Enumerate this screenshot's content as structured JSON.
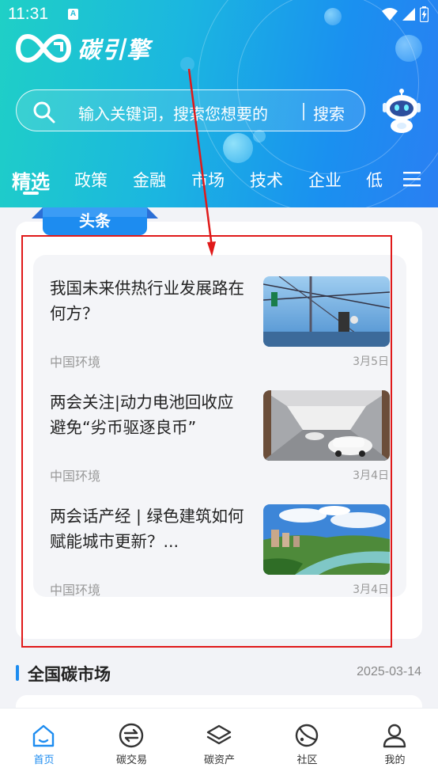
{
  "status_bar": {
    "time": "11:31",
    "notification_badge": "A"
  },
  "app": {
    "name": "碳引擎",
    "accent_color": "#1d8cf0"
  },
  "search": {
    "placeholder": "输入关键词，搜索您想要的",
    "button_label": "搜索"
  },
  "tabs": [
    {
      "label": "精选",
      "active": true
    },
    {
      "label": "政策",
      "active": false
    },
    {
      "label": "金融",
      "active": false
    },
    {
      "label": "市场",
      "active": false
    },
    {
      "label": "技术",
      "active": false
    },
    {
      "label": "企业",
      "active": false
    },
    {
      "label": "低",
      "active": false
    }
  ],
  "headlines": {
    "tag": "头条",
    "items": [
      {
        "title": "我国未来供热行业发展路在何方？",
        "source": "中国环境",
        "date": "3月5日",
        "thumb": "power-grid-photo"
      },
      {
        "title": "两会关注|动力电池回收应避免“劣币驱逐良币”",
        "source": "中国环境",
        "date": "3月4日",
        "thumb": "car-factory-photo"
      },
      {
        "title": "两会话产经 | 绿色建筑如何赋能城市更新？...",
        "source": "中国环境",
        "date": "3月4日",
        "thumb": "city-landscape-photo"
      }
    ]
  },
  "carbon_market": {
    "title": "全国碳市场",
    "date": "2025-03-14"
  },
  "bottom_nav": [
    {
      "label": "首页",
      "icon": "home-icon",
      "active": true
    },
    {
      "label": "碳交易",
      "icon": "exchange-icon",
      "active": false
    },
    {
      "label": "碳资产",
      "icon": "layers-icon",
      "active": false
    },
    {
      "label": "社区",
      "icon": "planet-icon",
      "active": false
    },
    {
      "label": "我的",
      "icon": "user-icon",
      "active": false
    }
  ]
}
